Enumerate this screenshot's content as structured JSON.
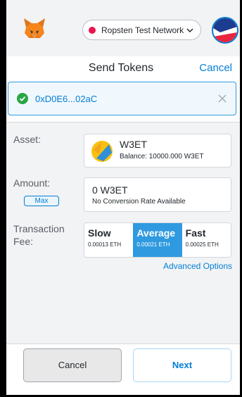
{
  "header": {
    "network_label": "Ropsten Test Network",
    "network_dot_color": "#e91550"
  },
  "page": {
    "title": "Send Tokens",
    "cancel_label": "Cancel"
  },
  "recipient": {
    "address": "0xD0E6...02aC"
  },
  "asset": {
    "label": "Asset:",
    "name": "W3ET",
    "balance": "Balance: 10000.000 W3ET"
  },
  "amount": {
    "label": "Amount:",
    "max_label": "Max",
    "value": "0 W3ET",
    "conversion": "No Conversion Rate Available"
  },
  "fee": {
    "label_line1": "Transaction",
    "label_line2": "Fee:",
    "options": [
      {
        "name": "Slow",
        "value": "0.00013 ETH"
      },
      {
        "name": "Average",
        "value": "0.00021 ETH"
      },
      {
        "name": "Fast",
        "value": "0.00025 ETH"
      }
    ],
    "selected": "Average",
    "advanced_label": "Advanced Options"
  },
  "footer": {
    "cancel_label": "Cancel",
    "next_label": "Next"
  },
  "colors": {
    "accent": "#037dd6",
    "selected_fee": "#2f9ae0"
  }
}
